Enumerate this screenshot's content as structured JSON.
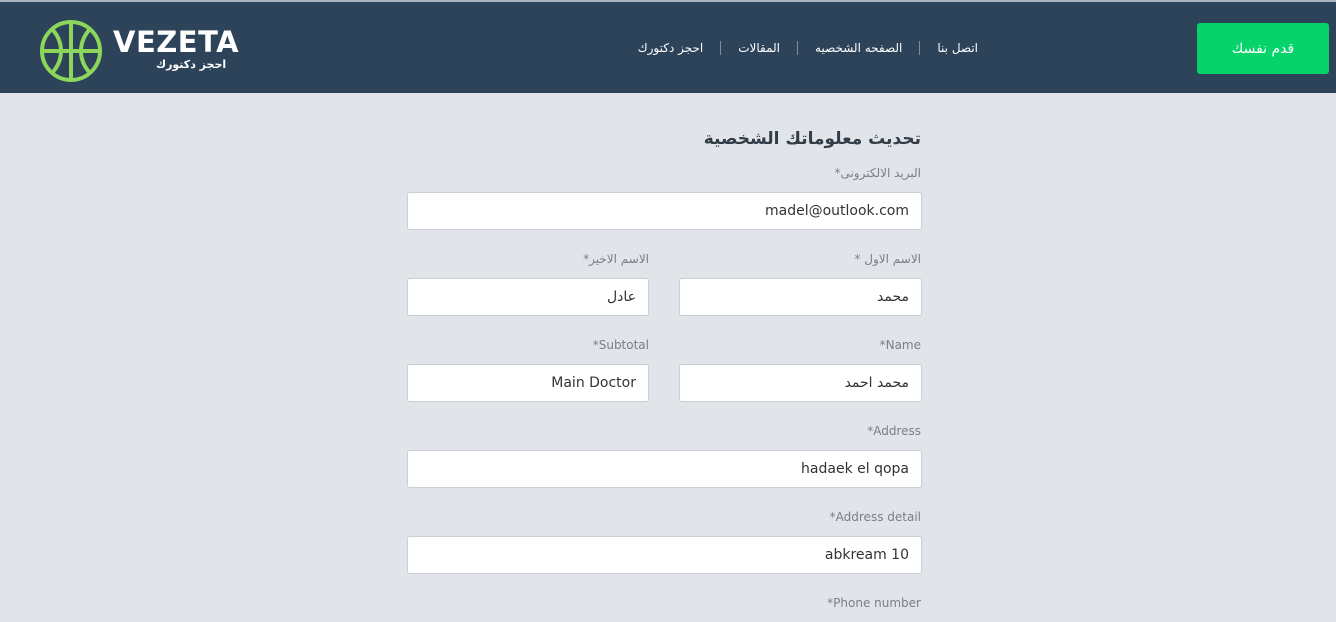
{
  "brand": {
    "name": "VEZETA",
    "tagline": "احجز دكتورك"
  },
  "nav": {
    "links": [
      "اتصل بنا",
      "الصفحه الشخصيه",
      "المقالات",
      "احجز دكتورك"
    ],
    "cta_label": "قدم نفسك"
  },
  "colors": {
    "navbar": "#2d4359",
    "accent": "#06d36a",
    "logo_icon": "#8bd65b",
    "page_background": "#e1e5ea"
  },
  "form": {
    "title": "تحديث معلوماتك الشخصية",
    "email": {
      "label": "البريد الالكترونى*",
      "value": "madel@outlook.com"
    },
    "first_name": {
      "label": "الاسم الاول *",
      "value": "محمد"
    },
    "last_name": {
      "label": "الاسم الاخير*",
      "value": "عادل"
    },
    "name": {
      "label": "*Name",
      "value": "محمد احمد"
    },
    "subtotal": {
      "label": "*Subtotal",
      "value": "Main Doctor"
    },
    "address": {
      "label": "*Address",
      "value": "hadaek el qopa"
    },
    "address_detail": {
      "label": "*Address detail",
      "value": "abkream 10"
    },
    "phone": {
      "label": "*Phone number"
    }
  }
}
